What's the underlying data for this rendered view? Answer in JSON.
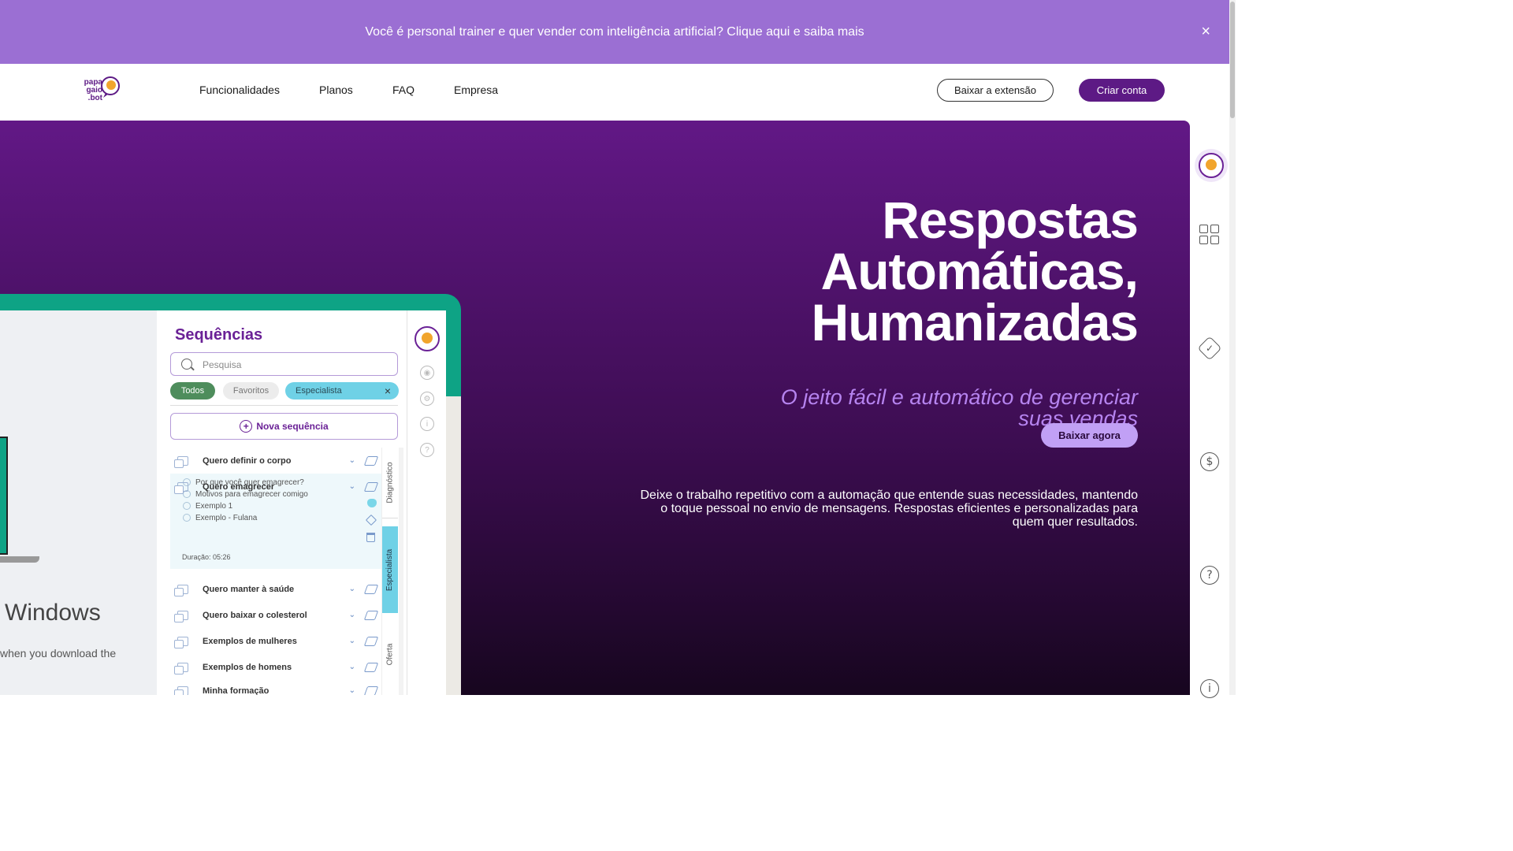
{
  "banner": {
    "text": "Você é personal trainer e quer vender com inteligência artificial? Clique aqui e saiba mais",
    "close": "×"
  },
  "logo": {
    "line1": "papa",
    "line2": "gaio",
    "line3": ".bot"
  },
  "nav": {
    "links": [
      "Funcionalidades",
      "Planos",
      "FAQ",
      "Empresa"
    ],
    "download_extension": "Baixar a extensão",
    "create_account": "Criar conta"
  },
  "hero": {
    "headline_1": "Respostas",
    "headline_2": "Automáticas,",
    "headline_3": "Humanizadas",
    "subhead_1": "O jeito fácil e automático de gerenciar",
    "subhead_2": "suas vendas",
    "description_1": "Deixe o trabalho repetitivo com a automação que entende suas necessidades, mantendo",
    "description_2": "o toque pessoal no envio de mensagens. Respostas eficientes e personalizadas para",
    "description_3": "quem quer resultados.",
    "cta": "Baixar agora"
  },
  "mockup": {
    "windows_text": "Windows",
    "windows_sub": "when you download the",
    "panel_title": "Sequências",
    "search_placeholder": "Pesquisa",
    "chips": {
      "all": "Todos",
      "favorites": "Favoritos",
      "specialist": "Especialista",
      "clear": "×"
    },
    "new_sequence": "Nova sequência",
    "new_sequence_icon": "+",
    "rows": [
      "Quero definir o corpo",
      "Quero emagrecer",
      "Quero manter à saúde",
      "Quero baixar o colesterol",
      "Exemplos de mulheres",
      "Exemplos de homens",
      "Minha formação"
    ],
    "chevron": "⌄",
    "expanded_items": [
      "Por que você quer emagrecer?",
      "Motivos para emagrecer comigo",
      "Exemplo 1",
      "Exemplo - Fulana"
    ],
    "duration": "Duração: 05:26",
    "side_tabs": {
      "diagnostic": "Diagnóstico",
      "specialist": "Especialista",
      "offer": "Oferta"
    },
    "rail_icons": [
      "eye-icon",
      "gear-icon",
      "info-icon",
      "help-icon"
    ],
    "rail_glyphs": {
      "eye": "◉",
      "gear": "⚙",
      "info": "i",
      "help": "?"
    }
  },
  "side_panel": {
    "icons": [
      "logo-icon",
      "grid-icon",
      "badge-check-icon",
      "dollar-icon",
      "help-icon",
      "info-icon"
    ],
    "badge_glyph": "✓",
    "dollar_glyph": "$",
    "help_glyph": "?",
    "info_glyph": "i"
  },
  "colors": {
    "banner": "#9b6fd3",
    "brand": "#5d1a85",
    "hero_top": "#621886",
    "accent": "#b684f0",
    "green": "#0ea385",
    "cyan": "#6fd1e6"
  }
}
